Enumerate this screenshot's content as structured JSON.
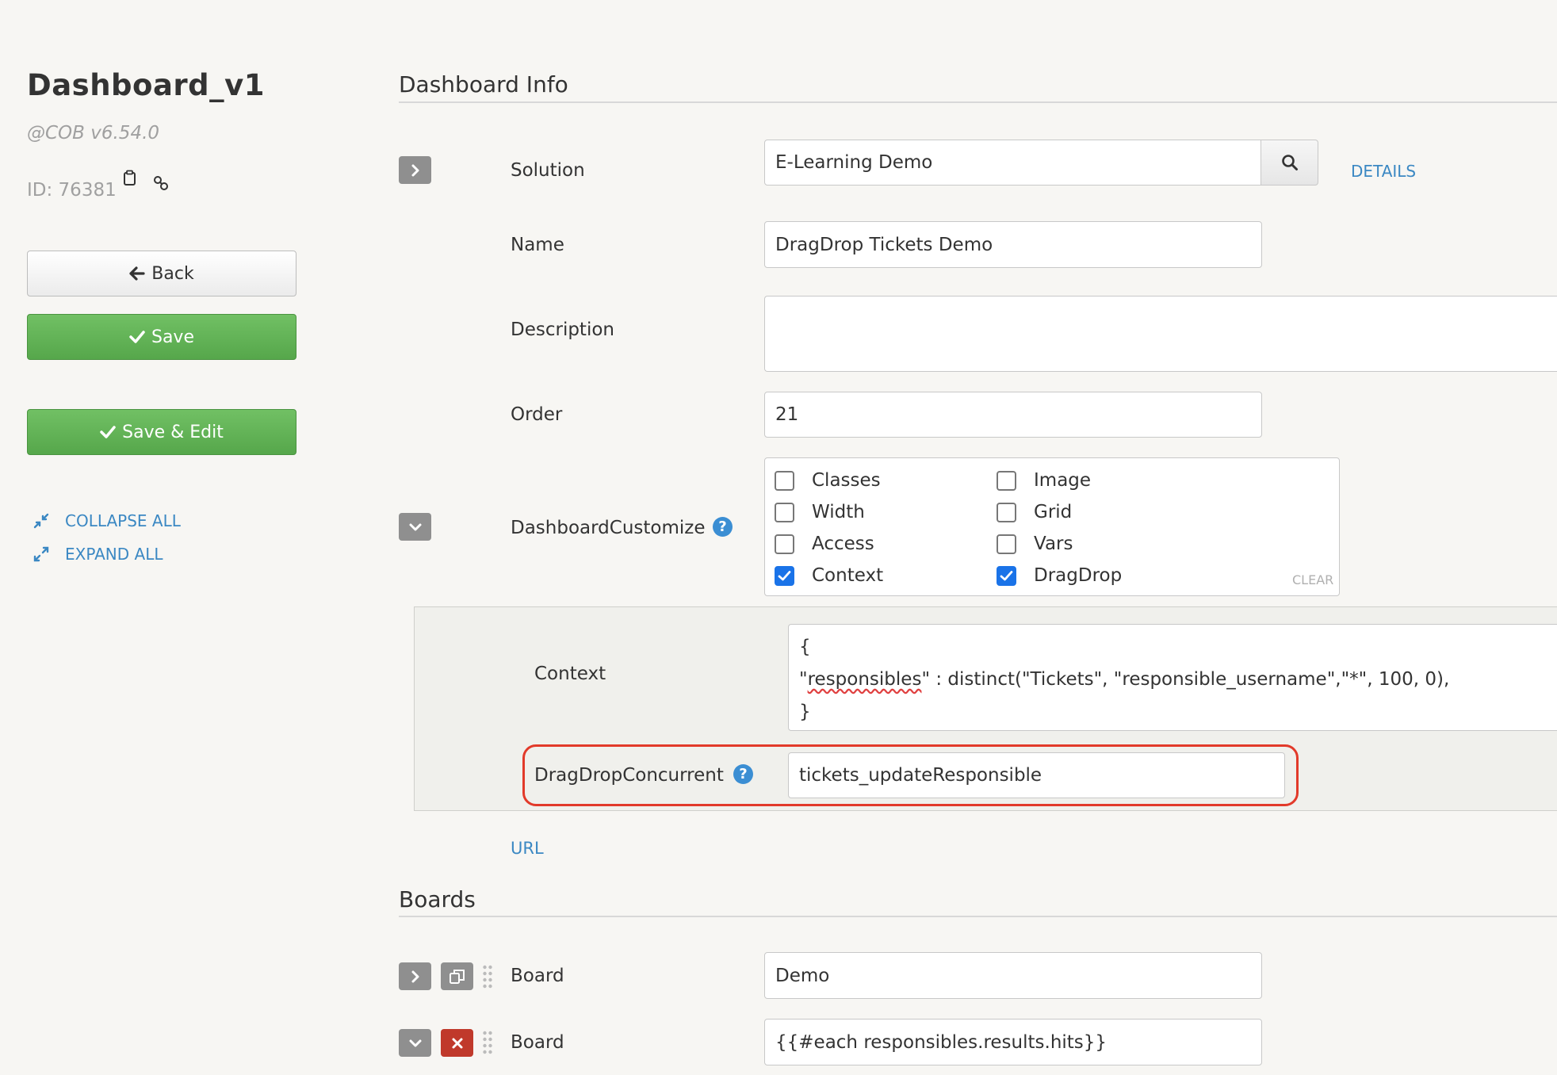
{
  "sidebar": {
    "title": "Dashboard_v1",
    "version": "@COB v6.54.0",
    "id_text": "ID: 76381",
    "back_label": "Back",
    "save_label": "Save",
    "save_edit_label": "Save & Edit",
    "collapse_all": "COLLAPSE ALL",
    "expand_all": "EXPAND ALL"
  },
  "dashboard_info": {
    "section_title": "Dashboard Info",
    "solution_label": "Solution",
    "solution_value": "E-Learning Demo",
    "details_link": "DETAILS",
    "name_label": "Name",
    "name_value": "DragDrop Tickets Demo",
    "description_label": "Description",
    "description_value": "",
    "order_label": "Order",
    "order_value": "21",
    "customize_label": "DashboardCustomize",
    "options": [
      {
        "label": "Classes",
        "checked": false
      },
      {
        "label": "Width",
        "checked": false
      },
      {
        "label": "Access",
        "checked": false
      },
      {
        "label": "Context",
        "checked": true
      },
      {
        "label": "Image",
        "checked": false
      },
      {
        "label": "Grid",
        "checked": false
      },
      {
        "label": "Vars",
        "checked": false
      },
      {
        "label": "DragDrop",
        "checked": true
      }
    ],
    "clear_label": "CLEAR",
    "context_label": "Context",
    "context_lines": [
      "{",
      "\"responsibles\" : distinct(\"Tickets\", \"responsible_username\",\"*\", 100, 0),",
      "}"
    ],
    "context_squiggle_word": "responsibles",
    "dragdrop_label": "DragDropConcurrent",
    "dragdrop_value": "tickets_updateResponsible",
    "url_link": "URL"
  },
  "boards": {
    "section_title": "Boards",
    "items": [
      {
        "label": "Board",
        "value": "Demo"
      },
      {
        "label": "Board",
        "value": "{{#each responsibles.results.hits}}"
      }
    ]
  },
  "colors": {
    "accent_link": "#3b88c3",
    "save_green": "#5cb85c",
    "highlight_red": "#e23a2a",
    "checkbox_blue": "#1a73e8",
    "delete_red": "#c0392b"
  }
}
